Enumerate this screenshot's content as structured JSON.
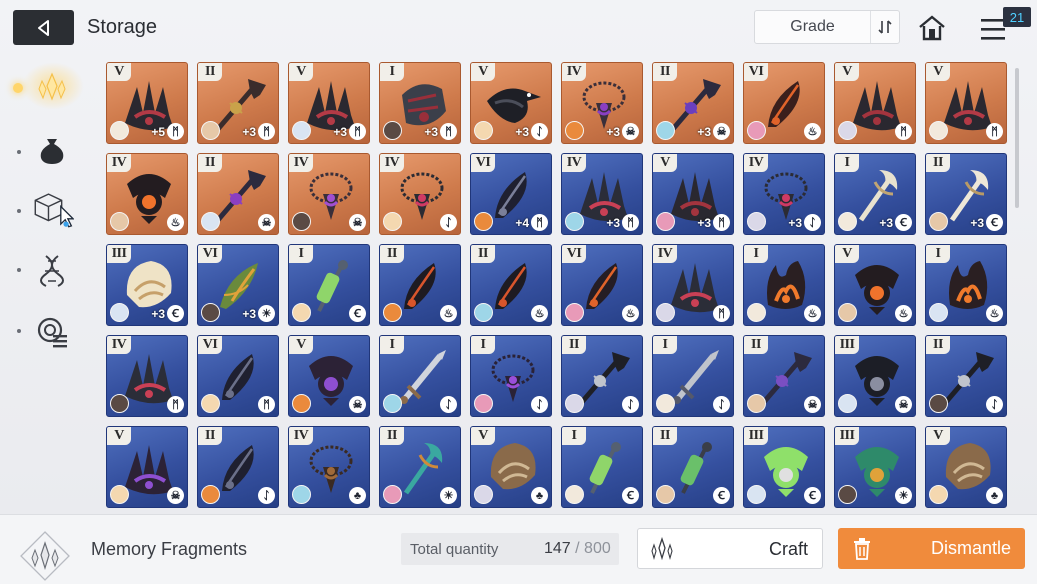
{
  "header": {
    "title": "Storage",
    "sort_label": "Grade",
    "notification_count": "21"
  },
  "sidebar": {
    "tabs": [
      {
        "name": "memory-fragments",
        "icon": "crystal-icon",
        "active": true
      },
      {
        "name": "materials",
        "icon": "pouch-icon",
        "active": false
      },
      {
        "name": "items",
        "icon": "cube-icon",
        "active": false
      },
      {
        "name": "genes",
        "icon": "dna-icon",
        "active": false
      },
      {
        "name": "tickets",
        "icon": "target-list-icon",
        "active": false
      }
    ]
  },
  "colors": {
    "gold_frame": "#d4834f",
    "blue_frame": "#35509f",
    "dismantle": "#f08b3c"
  },
  "grid": {
    "items": [
      {
        "grade": "V",
        "rarity": "gold",
        "plus": "+5",
        "element": "ᛗ",
        "art": "claw",
        "c1": "#2a2830",
        "c2": "#b33a46"
      },
      {
        "grade": "II",
        "rarity": "gold",
        "plus": "+3",
        "element": "ᛗ",
        "art": "spear",
        "c1": "#3a2c2c",
        "c2": "#c9a24a"
      },
      {
        "grade": "V",
        "rarity": "gold",
        "plus": "+3",
        "element": "ᛗ",
        "art": "claw",
        "c1": "#2a2830",
        "c2": "#b33a46"
      },
      {
        "grade": "I",
        "rarity": "gold",
        "plus": "+3",
        "element": "ᛗ",
        "art": "gauntlet",
        "c1": "#3b3f4a",
        "c2": "#9a2f3a"
      },
      {
        "grade": "V",
        "rarity": "gold",
        "plus": "+3",
        "element": "ᛇ",
        "art": "bird",
        "c1": "#1e1f26",
        "c2": "#4b4e5a"
      },
      {
        "grade": "IV",
        "rarity": "gold",
        "plus": "+3",
        "element": "☠",
        "art": "chain",
        "c1": "#3a2f3a",
        "c2": "#8a3fc2"
      },
      {
        "grade": "II",
        "rarity": "gold",
        "plus": "+3",
        "element": "☠",
        "art": "spear",
        "c1": "#2c2a3e",
        "c2": "#6a3fbf"
      },
      {
        "grade": "VI",
        "rarity": "gold",
        "plus": "",
        "element": "♨",
        "art": "feather",
        "c1": "#3a1f1c",
        "c2": "#e0632a"
      },
      {
        "grade": "V",
        "rarity": "gold",
        "plus": "",
        "element": "ᛗ",
        "art": "claw",
        "c1": "#2a2830",
        "c2": "#a3343e"
      },
      {
        "grade": "V",
        "rarity": "gold",
        "plus": "",
        "element": "ᛗ",
        "art": "claw",
        "c1": "#2a2830",
        "c2": "#b33a46"
      },
      {
        "grade": "IV",
        "rarity": "gold",
        "plus": "",
        "element": "♨",
        "art": "orb",
        "c1": "#231c20",
        "c2": "#f0732c"
      },
      {
        "grade": "II",
        "rarity": "gold",
        "plus": "",
        "element": "☠",
        "art": "spear",
        "c1": "#2c2a3e",
        "c2": "#8b3fc2"
      },
      {
        "grade": "IV",
        "rarity": "gold",
        "plus": "",
        "element": "☠",
        "art": "chain",
        "c1": "#3a2f3a",
        "c2": "#a04fd0"
      },
      {
        "grade": "IV",
        "rarity": "gold",
        "plus": "",
        "element": "ᛇ",
        "art": "chain",
        "c1": "#2b2b33",
        "c2": "#cf3a64"
      },
      {
        "grade": "VI",
        "rarity": "blue",
        "plus": "+4",
        "element": "ᛗ",
        "art": "feather",
        "c1": "#1f2030",
        "c2": "#7a7f99"
      },
      {
        "grade": "IV",
        "rarity": "blue",
        "plus": "+3",
        "element": "ᛗ",
        "art": "claw",
        "c1": "#2b2d38",
        "c2": "#c94055"
      },
      {
        "grade": "V",
        "rarity": "blue",
        "plus": "+3",
        "element": "ᛗ",
        "art": "claw",
        "c1": "#2a2830",
        "c2": "#a3343e"
      },
      {
        "grade": "IV",
        "rarity": "blue",
        "plus": "+3",
        "element": "ᛇ",
        "art": "chain",
        "c1": "#2b2b33",
        "c2": "#cf3a64"
      },
      {
        "grade": "I",
        "rarity": "blue",
        "plus": "+3",
        "element": "Ꞓ",
        "art": "staff",
        "c1": "#e8e2cf",
        "c2": "#c0a574"
      },
      {
        "grade": "II",
        "rarity": "blue",
        "plus": "+3",
        "element": "Ꞓ",
        "art": "staff",
        "c1": "#eee8d8",
        "c2": "#b89a66"
      },
      {
        "grade": "III",
        "rarity": "blue",
        "plus": "+3",
        "element": "Ꞓ",
        "art": "shell",
        "c1": "#efe3c6",
        "c2": "#c6a06a"
      },
      {
        "grade": "VI",
        "rarity": "blue",
        "plus": "+3",
        "element": "☀",
        "art": "leaf",
        "c1": "#6a8a3c",
        "c2": "#e0a23a"
      },
      {
        "grade": "I",
        "rarity": "blue",
        "plus": "",
        "element": "Ꞓ",
        "art": "vial",
        "c1": "#8fd56a",
        "c2": "#556070"
      },
      {
        "grade": "II",
        "rarity": "blue",
        "plus": "",
        "element": "♨",
        "art": "feather",
        "c1": "#1e1b22",
        "c2": "#d8552c"
      },
      {
        "grade": "II",
        "rarity": "blue",
        "plus": "",
        "element": "♨",
        "art": "feather",
        "c1": "#1e1b22",
        "c2": "#d8552c"
      },
      {
        "grade": "VI",
        "rarity": "blue",
        "plus": "",
        "element": "♨",
        "art": "feather",
        "c1": "#251d24",
        "c2": "#e0632a"
      },
      {
        "grade": "IV",
        "rarity": "blue",
        "plus": "",
        "element": "ᛗ",
        "art": "claw",
        "c1": "#2b2d38",
        "c2": "#c94055"
      },
      {
        "grade": "I",
        "rarity": "blue",
        "plus": "",
        "element": "♨",
        "art": "flame",
        "c1": "#2a1f22",
        "c2": "#f07a2c"
      },
      {
        "grade": "V",
        "rarity": "blue",
        "plus": "",
        "element": "♨",
        "art": "orb",
        "c1": "#231c20",
        "c2": "#f0732c"
      },
      {
        "grade": "I",
        "rarity": "blue",
        "plus": "",
        "element": "♨",
        "art": "flame",
        "c1": "#2a1f22",
        "c2": "#f07a2c"
      },
      {
        "grade": "IV",
        "rarity": "blue",
        "plus": "",
        "element": "ᛗ",
        "art": "claw",
        "c1": "#2b2d38",
        "c2": "#c94055"
      },
      {
        "grade": "VI",
        "rarity": "blue",
        "plus": "",
        "element": "ᛗ",
        "art": "feather",
        "c1": "#1f2030",
        "c2": "#6b708a"
      },
      {
        "grade": "V",
        "rarity": "blue",
        "plus": "",
        "element": "☠",
        "art": "orb",
        "c1": "#2c2236",
        "c2": "#8e4fd0"
      },
      {
        "grade": "I",
        "rarity": "blue",
        "plus": "",
        "element": "ᛇ",
        "art": "sword",
        "c1": "#d0d4dc",
        "c2": "#8a6a4a"
      },
      {
        "grade": "I",
        "rarity": "blue",
        "plus": "",
        "element": "ᛇ",
        "art": "chain",
        "c1": "#2a2236",
        "c2": "#9a4fd8"
      },
      {
        "grade": "II",
        "rarity": "blue",
        "plus": "",
        "element": "ᛇ",
        "art": "spear",
        "c1": "#1e1f26",
        "c2": "#c0c4cc"
      },
      {
        "grade": "I",
        "rarity": "blue",
        "plus": "",
        "element": "ᛇ",
        "art": "sword",
        "c1": "#c0c4cc",
        "c2": "#55596a"
      },
      {
        "grade": "II",
        "rarity": "blue",
        "plus": "",
        "element": "☠",
        "art": "spear",
        "c1": "#2c2a3e",
        "c2": "#7a4fc2"
      },
      {
        "grade": "III",
        "rarity": "blue",
        "plus": "",
        "element": "☠",
        "art": "orb",
        "c1": "#1c1e26",
        "c2": "#8a8ea0"
      },
      {
        "grade": "II",
        "rarity": "blue",
        "plus": "",
        "element": "ᛇ",
        "art": "spear",
        "c1": "#1e1f26",
        "c2": "#c0c4cc"
      },
      {
        "grade": "V",
        "rarity": "blue",
        "plus": "",
        "element": "☠",
        "art": "claw",
        "c1": "#2c2236",
        "c2": "#8e4fd0"
      },
      {
        "grade": "II",
        "rarity": "blue",
        "plus": "",
        "element": "ᛇ",
        "art": "feather",
        "c1": "#1f2030",
        "c2": "#6b708a"
      },
      {
        "grade": "IV",
        "rarity": "blue",
        "plus": "",
        "element": "♣",
        "art": "chain",
        "c1": "#3a2a22",
        "c2": "#a06a3a"
      },
      {
        "grade": "II",
        "rarity": "blue",
        "plus": "",
        "element": "☀",
        "art": "staff",
        "c1": "#3aa8a0",
        "c2": "#d08a3a"
      },
      {
        "grade": "V",
        "rarity": "blue",
        "plus": "",
        "element": "♣",
        "art": "shell",
        "c1": "#8a6a4a",
        "c2": "#d0b894"
      },
      {
        "grade": "I",
        "rarity": "blue",
        "plus": "",
        "element": "Ꞓ",
        "art": "vial",
        "c1": "#8fd56a",
        "c2": "#556070"
      },
      {
        "grade": "II",
        "rarity": "blue",
        "plus": "",
        "element": "Ꞓ",
        "art": "vial",
        "c1": "#6ac06a",
        "c2": "#3a3e48"
      },
      {
        "grade": "III",
        "rarity": "blue",
        "plus": "",
        "element": "Ꞓ",
        "art": "orb",
        "c1": "#8fe06a",
        "c2": "#e0e0e0"
      },
      {
        "grade": "III",
        "rarity": "blue",
        "plus": "",
        "element": "☀",
        "art": "orb",
        "c1": "#2e8a6a",
        "c2": "#e0a23a"
      },
      {
        "grade": "V",
        "rarity": "blue",
        "plus": "",
        "element": "♣",
        "art": "shell",
        "c1": "#8a6a4a",
        "c2": "#d0b894"
      }
    ]
  },
  "footer": {
    "category_name": "Memory Fragments",
    "quantity_label": "Total quantity",
    "quantity_current": "147",
    "quantity_sep": " / ",
    "quantity_max": "800",
    "craft_label": "Craft",
    "dismantle_label": "Dismantle"
  }
}
